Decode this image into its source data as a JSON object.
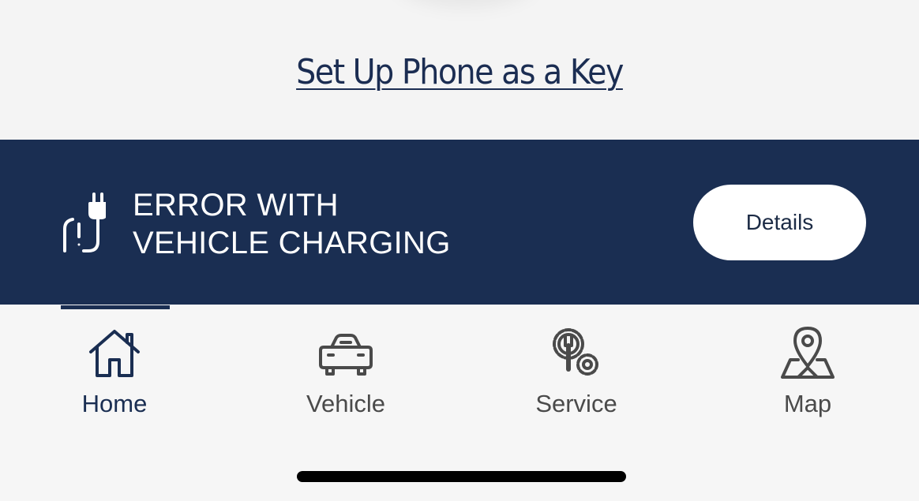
{
  "phone_key": {
    "link_text": "Set Up Phone as a Key"
  },
  "alert": {
    "icon": "charging-error-icon",
    "line1": "ERROR WITH",
    "line2": "VEHICLE CHARGING",
    "button_label": "Details"
  },
  "tabs": [
    {
      "label": "Home",
      "icon": "home-icon",
      "active": true
    },
    {
      "label": "Vehicle",
      "icon": "car-icon",
      "active": false
    },
    {
      "label": "Service",
      "icon": "service-icon",
      "active": false
    },
    {
      "label": "Map",
      "icon": "map-pin-icon",
      "active": false
    }
  ],
  "colors": {
    "brand_navy": "#1a2e52",
    "background": "#f5f5f5",
    "inactive_icon": "#4a4a4a"
  }
}
